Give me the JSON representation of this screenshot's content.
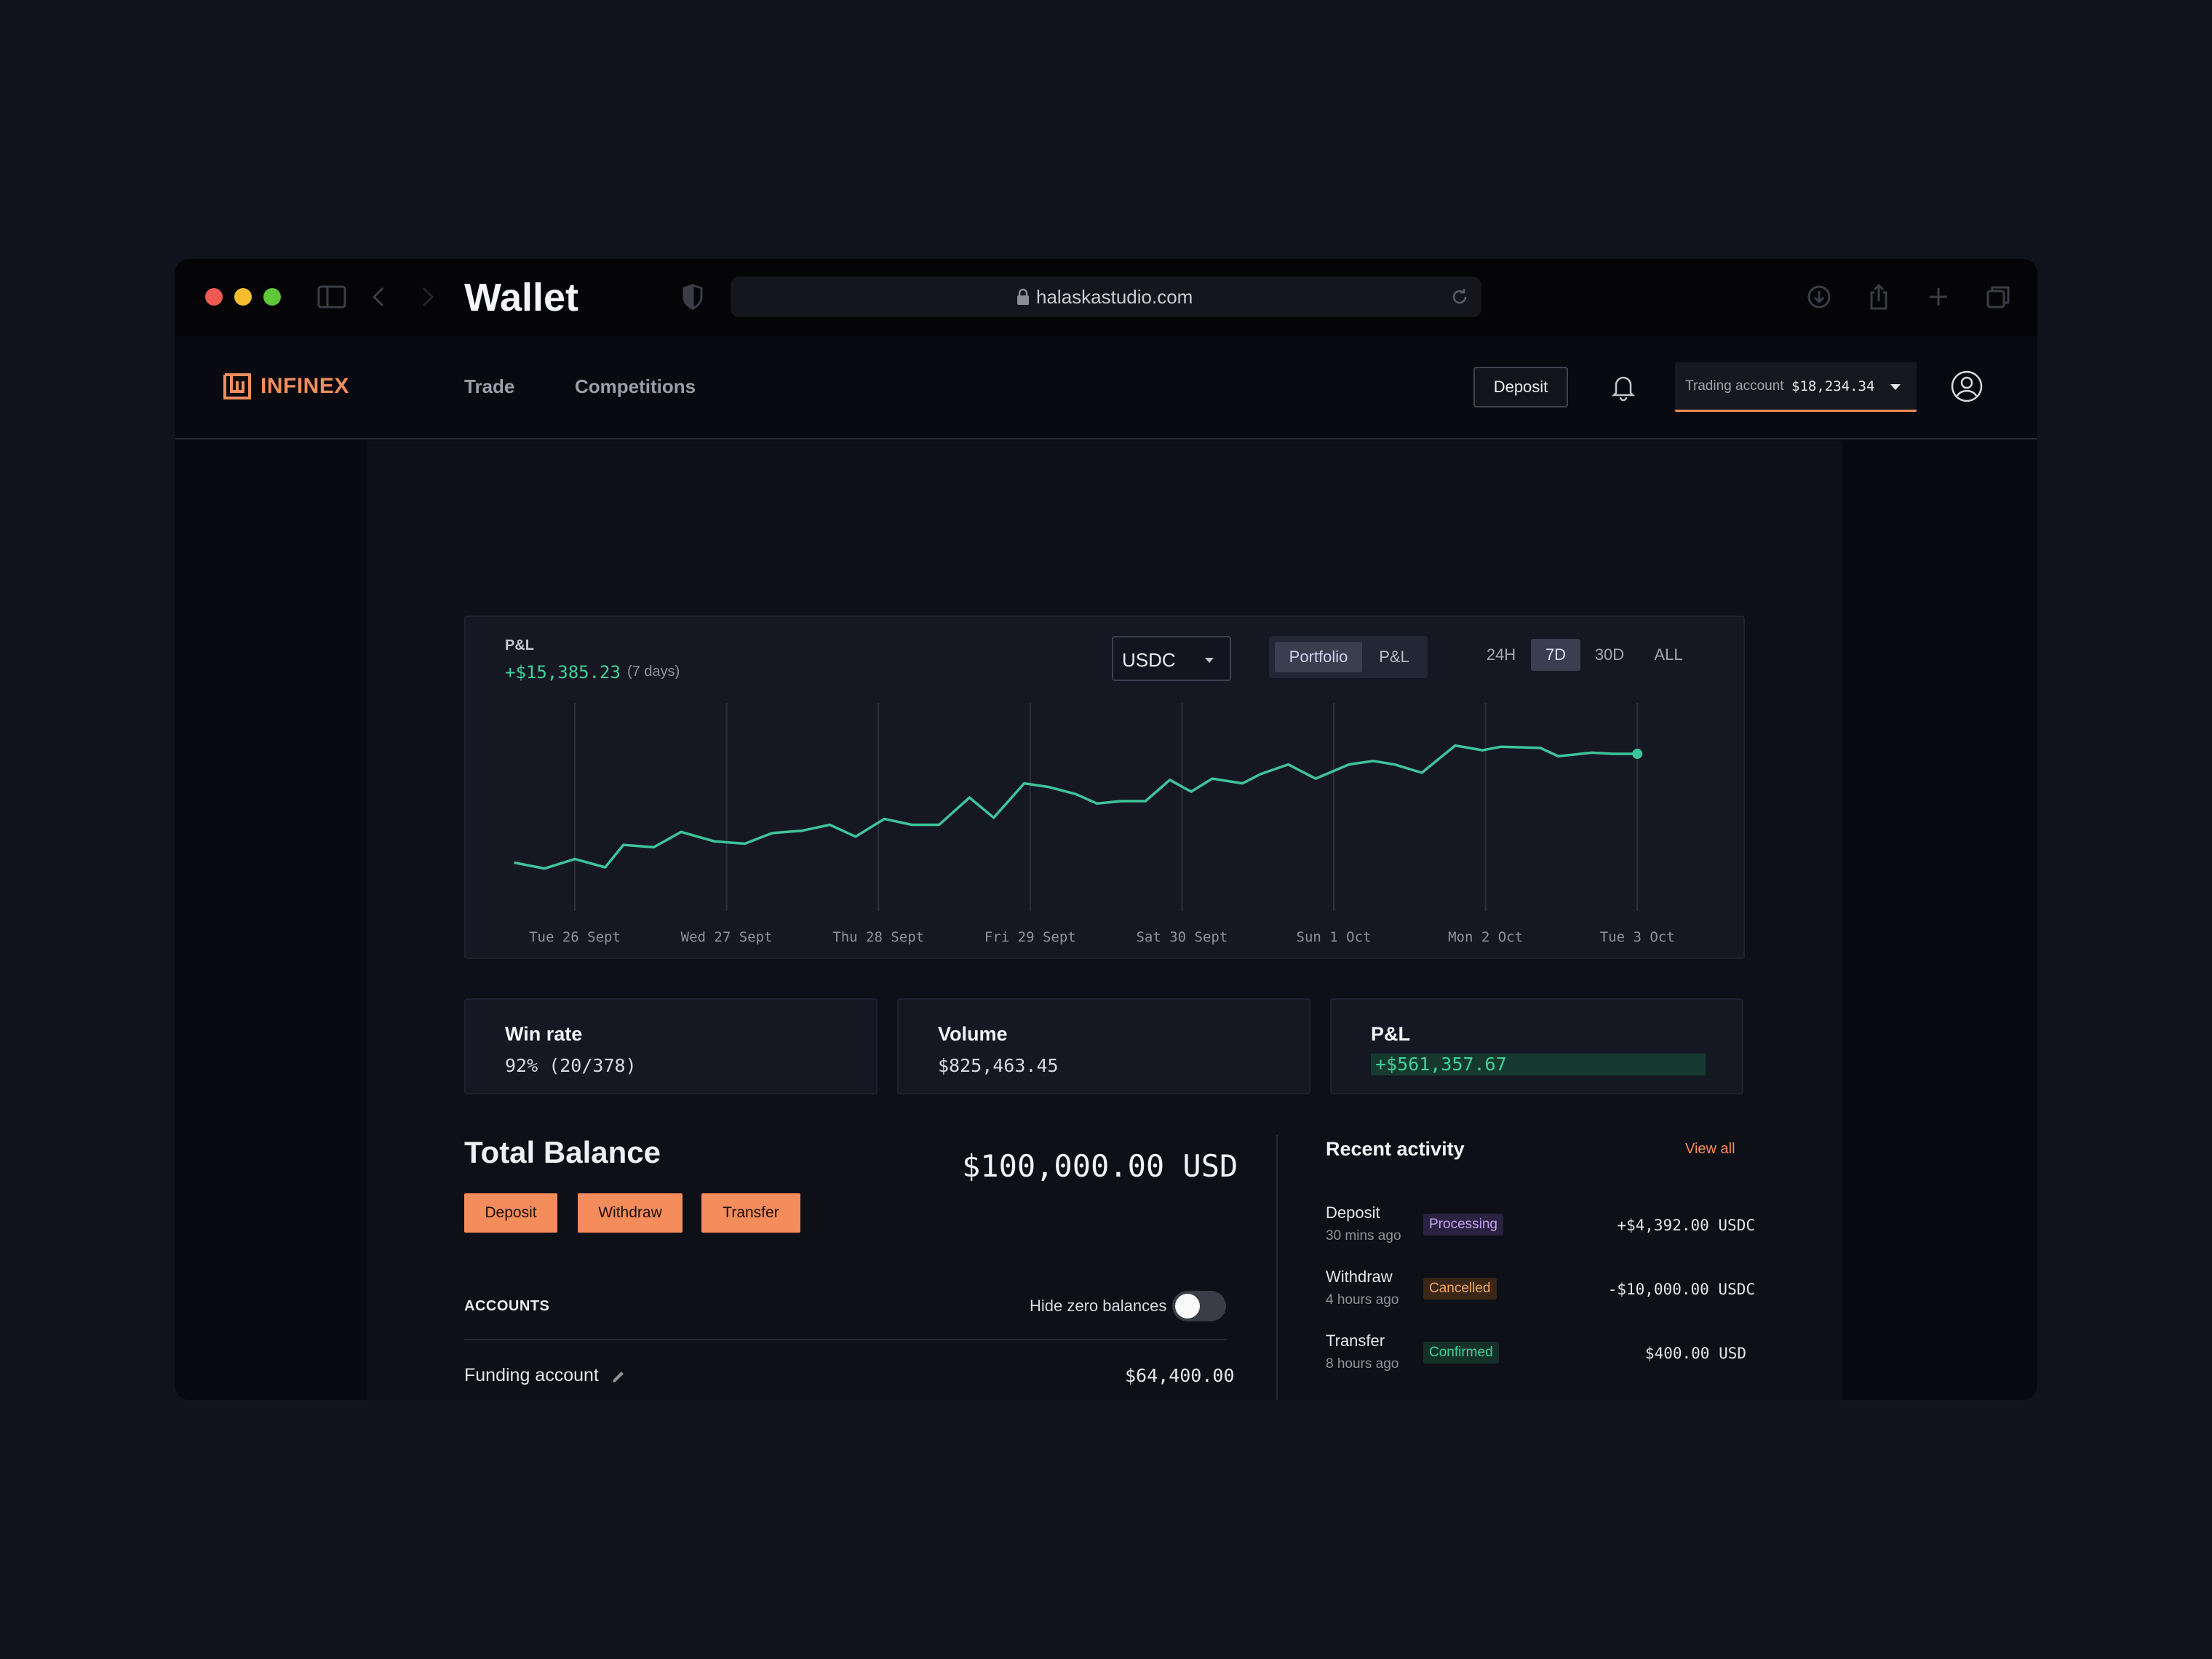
{
  "browser": {
    "url": "halaskastudio.com",
    "traffic_colors": [
      "#ee5a52",
      "#f5bd2e",
      "#5fc838"
    ]
  },
  "nav": {
    "brand": "INFINEX",
    "links": [
      "Trade",
      "Competitions"
    ],
    "deposit_label": "Deposit",
    "account_label": "Trading account",
    "account_value": "$18,234.34"
  },
  "page": {
    "title": "Wallet"
  },
  "chart_card": {
    "label": "P&L",
    "value": "+$15,385.23",
    "period": "(7 days)",
    "currency": "USDC",
    "view_options": [
      "Portfolio",
      "P&L"
    ],
    "active_view": "Portfolio",
    "ranges": [
      "24H",
      "7D",
      "30D",
      "ALL"
    ],
    "active_range": "7D"
  },
  "chart_data": {
    "type": "line",
    "title": "",
    "xlabel": "",
    "ylabel": "",
    "x_ticks": [
      "Tue 26 Sept",
      "Wed 27 Sept",
      "Thu 28 Sept",
      "Fri 29 Sept",
      "Sat 30 Sept",
      "Sun 1 Oct",
      "Mon 2 Oct",
      "Tue 3 Oct"
    ],
    "x_range": [
      -0.4,
      7.0
    ],
    "ylim": [
      0,
      120
    ],
    "grid": "vertical",
    "line_color": "#3ec49a",
    "series": [
      {
        "x": [
          -0.4,
          -0.2,
          0.0,
          0.2,
          0.32,
          0.52,
          0.7,
          0.92,
          1.12,
          1.3,
          1.5,
          1.68,
          1.85,
          2.04,
          2.22,
          2.4,
          2.6,
          2.76,
          2.96,
          3.12,
          3.3,
          3.44,
          3.6,
          3.76,
          3.92,
          4.06,
          4.2,
          4.4,
          4.52,
          4.7,
          4.88,
          5.1,
          5.26,
          5.4,
          5.58,
          5.8,
          5.98,
          6.1,
          6.36,
          6.48,
          6.7,
          6.84,
          7.0
        ],
        "y": [
          20,
          15,
          23,
          16,
          35,
          33,
          46,
          38,
          36,
          45,
          47,
          52,
          42,
          57,
          52,
          52,
          75,
          58,
          87,
          84,
          78,
          70,
          72,
          72,
          90,
          80,
          91,
          87,
          95,
          103,
          91,
          103,
          106,
          103,
          96,
          119,
          115,
          118,
          117,
          110,
          113,
          112,
          112
        ]
      }
    ]
  },
  "stats": [
    {
      "title": "Win rate",
      "value": "92% (20/378)"
    },
    {
      "title": "Volume",
      "value": "$825,463.45"
    },
    {
      "title": "P&L",
      "value": "+$561,357.67"
    }
  ],
  "balance": {
    "title": "Total Balance",
    "amount": "$100,000.00 USD",
    "actions": [
      "Deposit",
      "Withdraw",
      "Transfer"
    ],
    "accounts_label": "ACCOUNTS",
    "hide_zero_label": "Hide zero balances",
    "hide_zero_on": false,
    "funding_name": "Funding account",
    "funding_value": "$64,400.00"
  },
  "activity": {
    "title": "Recent activity",
    "view_all": "View all",
    "items": [
      {
        "type": "Deposit",
        "time": "30 mins ago",
        "status": "Processing",
        "status_color": "#c5a0f5",
        "status_bg": "#2b2140",
        "amount": "+$4,392.00 USDC"
      },
      {
        "type": "Withdraw",
        "time": "4 hours ago",
        "status": "Cancelled",
        "status_color": "#f0a560",
        "status_bg": "#3a2718",
        "amount": "-$10,000.00 USDC"
      },
      {
        "type": "Transfer",
        "time": "8 hours ago",
        "status": "Confirmed",
        "status_color": "#3fd197",
        "status_bg": "#143129",
        "amount": "$400.00 USD"
      }
    ]
  }
}
